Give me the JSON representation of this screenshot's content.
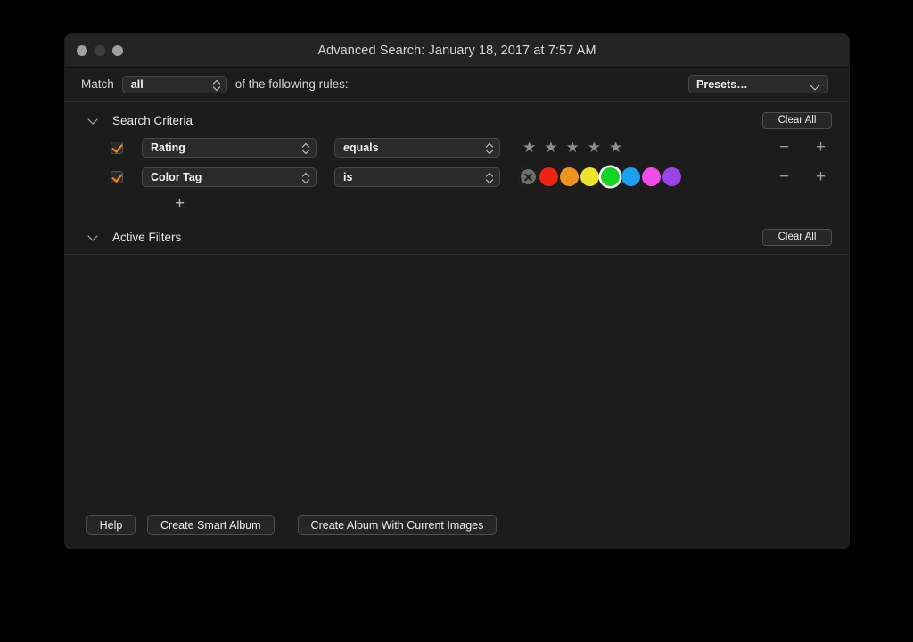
{
  "window": {
    "title": "Advanced Search: January 18, 2017 at 7:57 AM",
    "traffic_lights": {
      "close": "close-button",
      "minimize": "minimize-button",
      "zoom": "zoom-button"
    }
  },
  "match_row": {
    "label": "Match",
    "value": "all",
    "suffix": "of the following rules:",
    "presets_label": "Presets…"
  },
  "sections": {
    "search_criteria": {
      "title": "Search Criteria",
      "clear_all": "Clear All",
      "add_rule_glyph": "+",
      "rules": [
        {
          "checked": true,
          "field": "Rating",
          "operator": "equals",
          "control": "stars",
          "stars_total": 5,
          "stars_filled": 0,
          "remove_glyph": "−",
          "add_glyph": "+"
        },
        {
          "checked": true,
          "field": "Color Tag",
          "operator": "is",
          "control": "color-tags",
          "selected_color": "green",
          "remove_glyph": "−",
          "add_glyph": "+"
        }
      ]
    },
    "active_filters": {
      "title": "Active Filters",
      "clear_all": "Clear All"
    }
  },
  "color_tags": [
    {
      "name": "none",
      "hex": "#6e6e6e",
      "selected": false
    },
    {
      "name": "red",
      "hex": "#ee2316",
      "selected": false
    },
    {
      "name": "orange",
      "hex": "#ef9320",
      "selected": false
    },
    {
      "name": "yellow",
      "hex": "#ece32a",
      "selected": false
    },
    {
      "name": "green",
      "hex": "#12d422",
      "selected": true
    },
    {
      "name": "blue",
      "hex": "#1aa0ef",
      "selected": false
    },
    {
      "name": "pink",
      "hex": "#ef4cea",
      "selected": false
    },
    {
      "name": "purple",
      "hex": "#9b45e8",
      "selected": false
    }
  ],
  "footer": {
    "help": "Help",
    "create_smart_album": "Create Smart Album",
    "create_album_current": "Create Album With Current Images"
  },
  "colors": {
    "accent_checkbox": "#f08a21",
    "window_bg": "#1c1c1c",
    "titlebar_bg": "#232323",
    "desktop_bg": "#000000"
  }
}
